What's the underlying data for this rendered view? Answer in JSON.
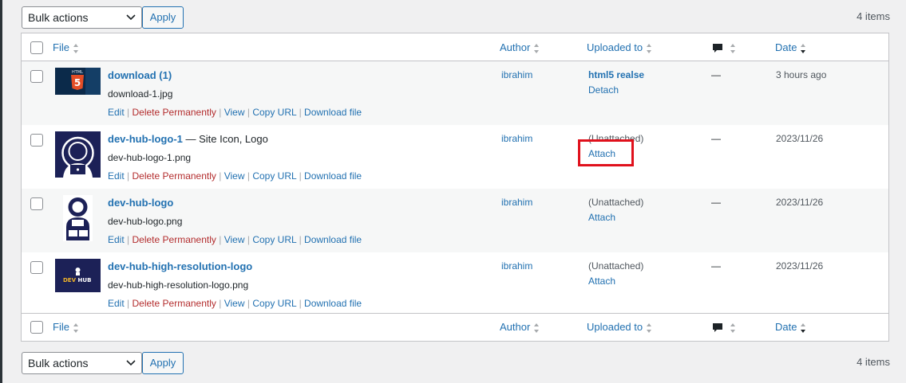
{
  "nav_top": {
    "bulk_label": "Bulk actions",
    "apply_label": "Apply",
    "count": "4 items"
  },
  "nav_bottom": {
    "bulk_label": "Bulk actions",
    "apply_label": "Apply",
    "count": "4 items"
  },
  "columns": {
    "file": "File",
    "author": "Author",
    "uploaded_to": "Uploaded to",
    "comments_icon": "comment-icon",
    "date": "Date"
  },
  "action_labels": {
    "edit": "Edit",
    "delete": "Delete Permanently",
    "view": "View",
    "copy": "Copy URL",
    "download": "Download file",
    "sep": "|"
  },
  "rows": [
    {
      "title": "download (1)",
      "state": "",
      "filename": "download-1.jpg",
      "author": "ibrahim",
      "uploaded_line1": "html5 realse",
      "uploaded_line2": "Detach",
      "comments": "—",
      "date": "3 hours ago"
    },
    {
      "title": "dev-hub-logo-1",
      "state": " — Site Icon, Logo",
      "filename": "dev-hub-logo-1.png",
      "author": "ibrahim",
      "uploaded_line1": "(Unattached)",
      "uploaded_line2": "Attach",
      "comments": "—",
      "date": "2023/11/26"
    },
    {
      "title": "dev-hub-logo",
      "state": "",
      "filename": "dev-hub-logo.png",
      "author": "ibrahim",
      "uploaded_line1": "(Unattached)",
      "uploaded_line2": "Attach",
      "comments": "—",
      "date": "2023/11/26"
    },
    {
      "title": "dev-hub-high-resolution-logo",
      "state": "",
      "filename": "dev-hub-high-resolution-logo.png",
      "author": "ibrahim",
      "uploaded_line1": "(Unattached)",
      "uploaded_line2": "Attach",
      "comments": "—",
      "date": "2023/11/26"
    }
  ],
  "thumb_text": {
    "html": "HTML",
    "five": "5",
    "dev": "DEV",
    "hub": "HUB"
  },
  "colors": {
    "link": "#2271b1",
    "delete": "#b32d2e",
    "highlight": "#e0111c",
    "logo_navy": "#1c2157",
    "logo_gold": "#f0b429"
  }
}
